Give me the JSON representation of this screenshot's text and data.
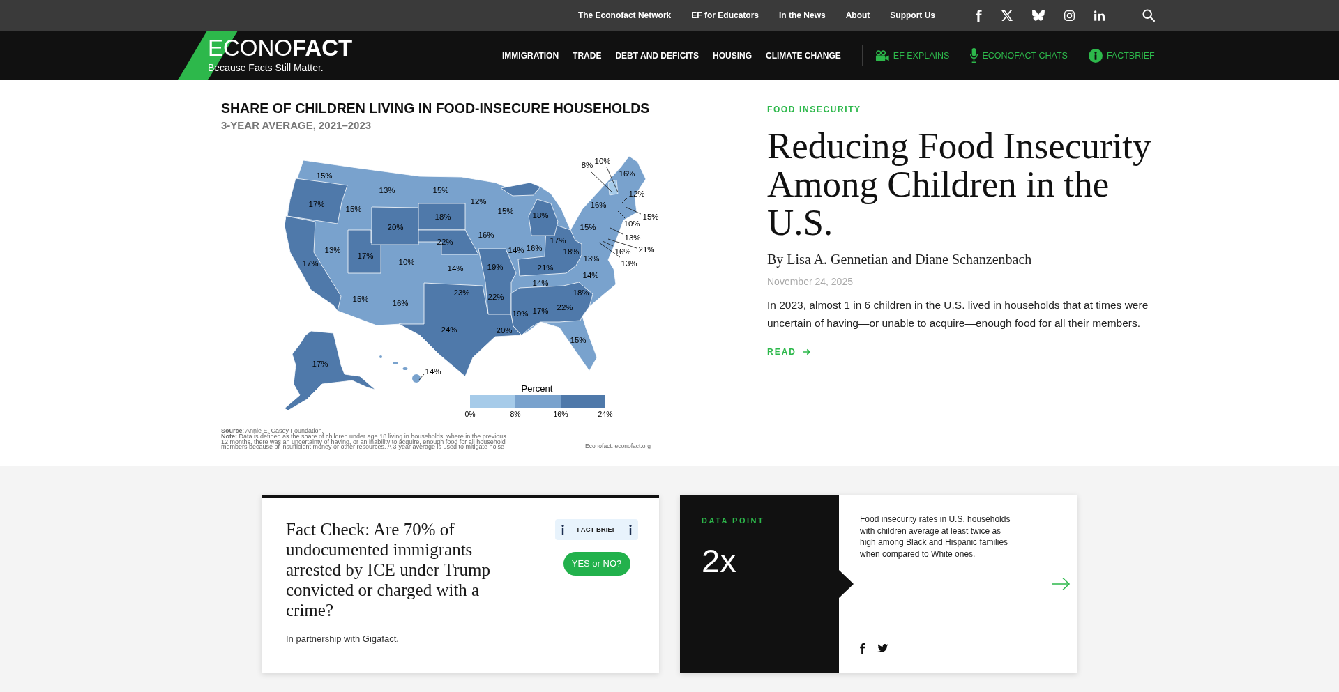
{
  "top_bar": {
    "links": [
      "The Econofact Network",
      "EF for Educators",
      "In the News",
      "About",
      "Support Us"
    ]
  },
  "header": {
    "logo": {
      "wordmark": "ECONO**FACT**",
      "tagline": "Because Facts Still Matter."
    },
    "nav": [
      "IMMIGRATION",
      "TRADE",
      "DEBT AND DEFICITS",
      "HOUSING",
      "CLIMATE CHANGE"
    ],
    "features": [
      "EF EXPLAINS",
      "ECONOFACT CHATS",
      "FACTBRIEF"
    ]
  },
  "featured": {
    "map_figure": {
      "title": "SHARE OF CHILDREN LIVING IN FOOD-INSECURE HOUSEHOLDS",
      "subtitle": "3-YEAR AVERAGE, 2021–2023",
      "map_labels": [
        "8%",
        "10%",
        "15%",
        "16%",
        "13%",
        "15%",
        "12%",
        "17%",
        "15%",
        "12%",
        "16%",
        "18%",
        "15%",
        "18%",
        "15%",
        "20%",
        "15%",
        "10%",
        "22%",
        "16%",
        "17%",
        "13%",
        "13%",
        "17%",
        "14%",
        "16%",
        "18%",
        "16%",
        "21%",
        "17%",
        "10%",
        "14%",
        "19%",
        "21%",
        "13%",
        "13%",
        "14%",
        "14%",
        "15%",
        "23%",
        "22%",
        "18%",
        "16%",
        "19%",
        "17%",
        "22%",
        "24%",
        "20%",
        "15%",
        "17%",
        "14%"
      ],
      "legend": {
        "title": "Percent",
        "ticks": [
          "0%",
          "8%",
          "16%",
          "24%"
        ]
      },
      "source": "**Source**: Annie E. Casey Foundation.",
      "note": "**Note:** Data is defined as the share of children under age 18 living in households, where in the previous 12 months, there was an uncertainty of having, or an inability to acquire, enough food for all household members because of insufficient money or other resources. A 3-year average is used to mitigate noise",
      "credit": "Econofact: econofact.org"
    },
    "article": {
      "category": "FOOD INSECURITY",
      "title": "Reducing Food Insecurity Among Children in the U.S.",
      "byline": "By Lisa A. Gennetian and Diane Schanzenbach",
      "date": "November 24, 2025",
      "summary": "In 2023, almost 1 in 6 children in the U.S. lived in households that at times were uncertain of having—or unable to acquire—enough food for all their members.",
      "read_link": "READ"
    }
  },
  "cards": {
    "fact_check": {
      "title": "Fact Check: Are 70% of undocumented immigrants arrested by ICE under Trump convicted or charged with a crime?",
      "badge": "FACT BRIEF",
      "button": "YES or NO?",
      "partnership": {
        "text": "In partnership with ",
        "link": "Gigafact",
        "end": "."
      }
    },
    "data_point": {
      "label": "DATA POINT",
      "value": "2x",
      "text": "Food insecurity rates in U.S. households with children average at least twice as high among Black and Hispanic families when compared to White ones."
    }
  }
}
